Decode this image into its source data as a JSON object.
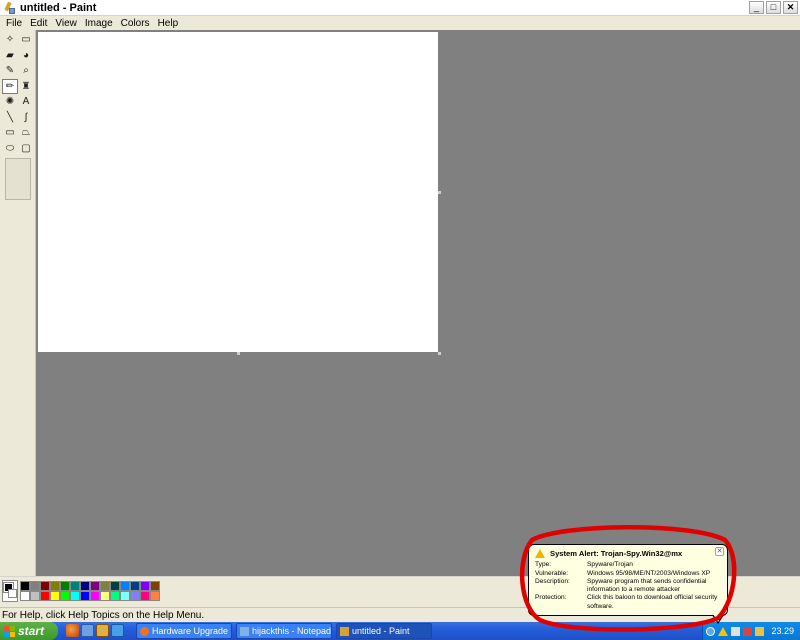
{
  "window": {
    "title": "untitled - Paint",
    "controls": [
      "_",
      "□",
      "✕"
    ]
  },
  "menu": [
    "File",
    "Edit",
    "View",
    "Image",
    "Colors",
    "Help"
  ],
  "tools": [
    {
      "name": "free-select-icon",
      "glyph": "✧"
    },
    {
      "name": "select-icon",
      "glyph": "▭"
    },
    {
      "name": "eraser-icon",
      "glyph": "▰"
    },
    {
      "name": "fill-icon",
      "glyph": "◕"
    },
    {
      "name": "pick-color-icon",
      "glyph": "✎"
    },
    {
      "name": "magnifier-icon",
      "glyph": "⌕"
    },
    {
      "name": "pencil-icon",
      "glyph": "✏"
    },
    {
      "name": "brush-icon",
      "glyph": "♜"
    },
    {
      "name": "airbrush-icon",
      "glyph": "✺"
    },
    {
      "name": "text-icon",
      "glyph": "A"
    },
    {
      "name": "line-icon",
      "glyph": "╲"
    },
    {
      "name": "curve-icon",
      "glyph": "∫"
    },
    {
      "name": "rectangle-icon",
      "glyph": "▭"
    },
    {
      "name": "polygon-icon",
      "glyph": "⏢"
    },
    {
      "name": "ellipse-icon",
      "glyph": "⬭"
    },
    {
      "name": "rounded-rectangle-icon",
      "glyph": "▢"
    }
  ],
  "palette": {
    "foreground": "#000000",
    "background": "#ffffff",
    "row1": [
      "#000000",
      "#808080",
      "#800000",
      "#808000",
      "#008000",
      "#008080",
      "#000080",
      "#800080",
      "#808040",
      "#004040",
      "#0080ff",
      "#004080",
      "#8000ff",
      "#804000"
    ],
    "row2": [
      "#ffffff",
      "#c0c0c0",
      "#ff0000",
      "#ffff00",
      "#00ff00",
      "#00ffff",
      "#0000ff",
      "#ff00ff",
      "#ffff80",
      "#00ff80",
      "#80ffff",
      "#8080ff",
      "#ff0080",
      "#ff8040"
    ]
  },
  "status": {
    "text": "For Help, click Help Topics on the Help Menu."
  },
  "taskbar": {
    "start_label": "start",
    "tasks": [
      {
        "label": "Hardware Upgrade F...",
        "icon_color": "#e8742a"
      },
      {
        "label": "hijackthis - Notepad",
        "icon_color": "#7fb3e8"
      },
      {
        "label": "untitled - Paint",
        "icon_color": "#d8a030"
      }
    ],
    "clock": "23.29"
  },
  "balloon": {
    "title": "System Alert: Trojan-Spy.Win32@mx",
    "rows": [
      {
        "key": "Type:",
        "value": "Spyware/Trojan"
      },
      {
        "key": "Vulnerable:",
        "value": "Windows 95/98/ME/NT/2003/Windows XP"
      },
      {
        "key": "Description:",
        "value": "Spyware program that sends confidential information to a remote attacker"
      },
      {
        "key": "Protection:",
        "value": "Click this baloon to download official security software."
      }
    ],
    "close": "✕"
  }
}
